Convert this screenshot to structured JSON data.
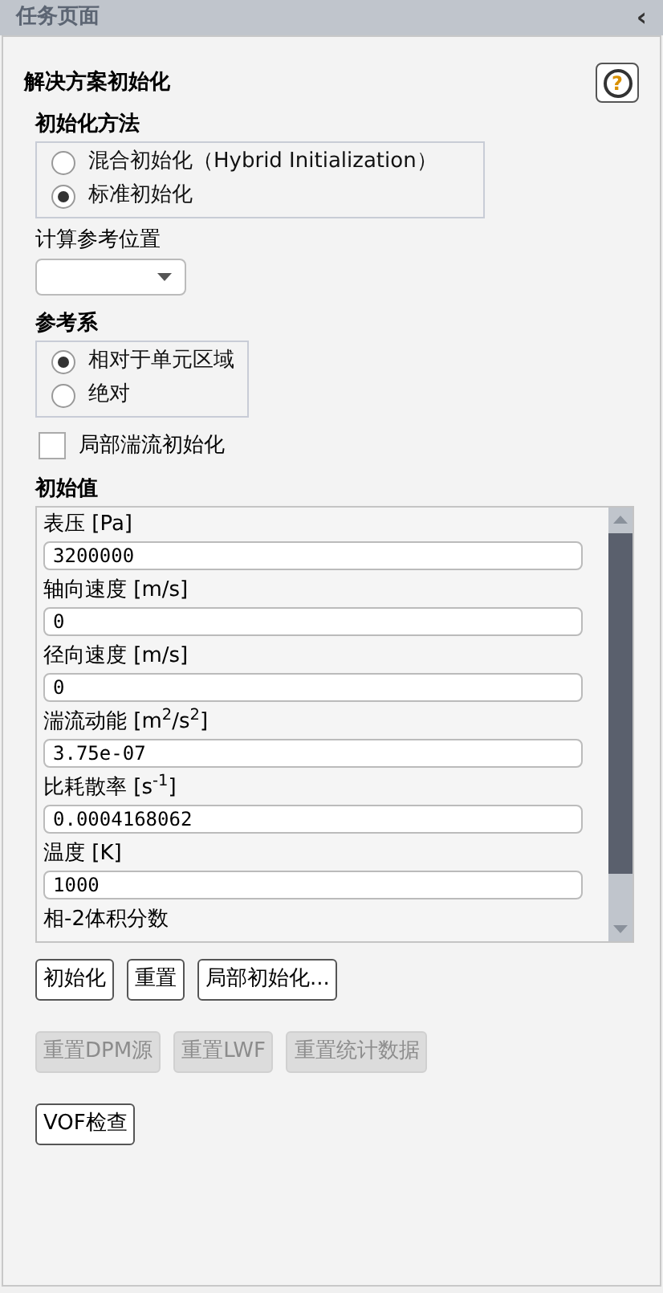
{
  "header": {
    "title": "任务页面",
    "collapse": "‹"
  },
  "panel": {
    "title": "解决方案初始化",
    "help": "?"
  },
  "method": {
    "label": "初始化方法",
    "options": [
      {
        "label": "混合初始化（Hybrid Initialization）",
        "selected": false
      },
      {
        "label": "标准初始化",
        "selected": true
      }
    ]
  },
  "compute_from": {
    "label": "计算参考位置"
  },
  "reference_frame": {
    "label": "参考系",
    "options": [
      {
        "label": "相对于单元区域",
        "selected": true
      },
      {
        "label": "绝对",
        "selected": false
      }
    ]
  },
  "local_turbulence": {
    "label": "局部湍流初始化",
    "checked": false
  },
  "initial_values": {
    "label": "初始值",
    "fields": [
      {
        "label": "表压 [Pa]",
        "value": "3200000"
      },
      {
        "label": "轴向速度 [m/s]",
        "value": "0"
      },
      {
        "label": "径向速度 [m/s]",
        "value": "0"
      },
      {
        "label": "湍流动能 [m$^{2}$/s$^{2}$]",
        "value": "3.75e-07"
      },
      {
        "label": "比耗散率 [s$^{-1}$]",
        "value": "0.0004168062"
      },
      {
        "label": "温度 [K]",
        "value": "1000"
      },
      {
        "label": "相-2体积分数"
      }
    ]
  },
  "button_rows": [
    [
      {
        "label": "初始化",
        "disabled": false
      },
      {
        "label": "重置",
        "disabled": false
      },
      {
        "label": "局部初始化...",
        "disabled": false
      }
    ],
    [
      {
        "label": "重置DPM源",
        "disabled": true
      },
      {
        "label": "重置LWF",
        "disabled": true
      },
      {
        "label": "重置统计数据",
        "disabled": true
      }
    ],
    [
      {
        "label": "VOF检查",
        "disabled": false
      }
    ]
  ]
}
